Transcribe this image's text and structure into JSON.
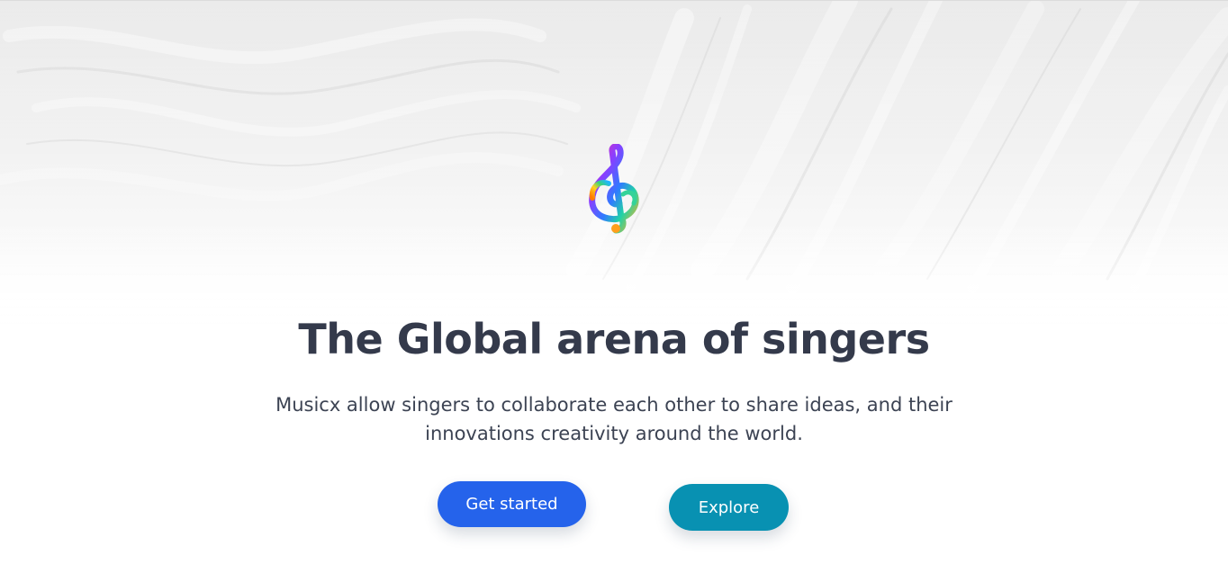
{
  "hero": {
    "logo_icon": "treble-clef-icon",
    "headline": "The Global arena of singers",
    "subtext": "Musicx allow singers to collaborate each other to share ideas, and their innovations creativity around the world.",
    "primary_button_label": "Get started",
    "secondary_button_label": "Explore"
  },
  "colors": {
    "primary_button": "#2563eb",
    "secondary_button": "#0891b2",
    "headline_text": "#343a4b",
    "body_text": "#3c4353"
  }
}
